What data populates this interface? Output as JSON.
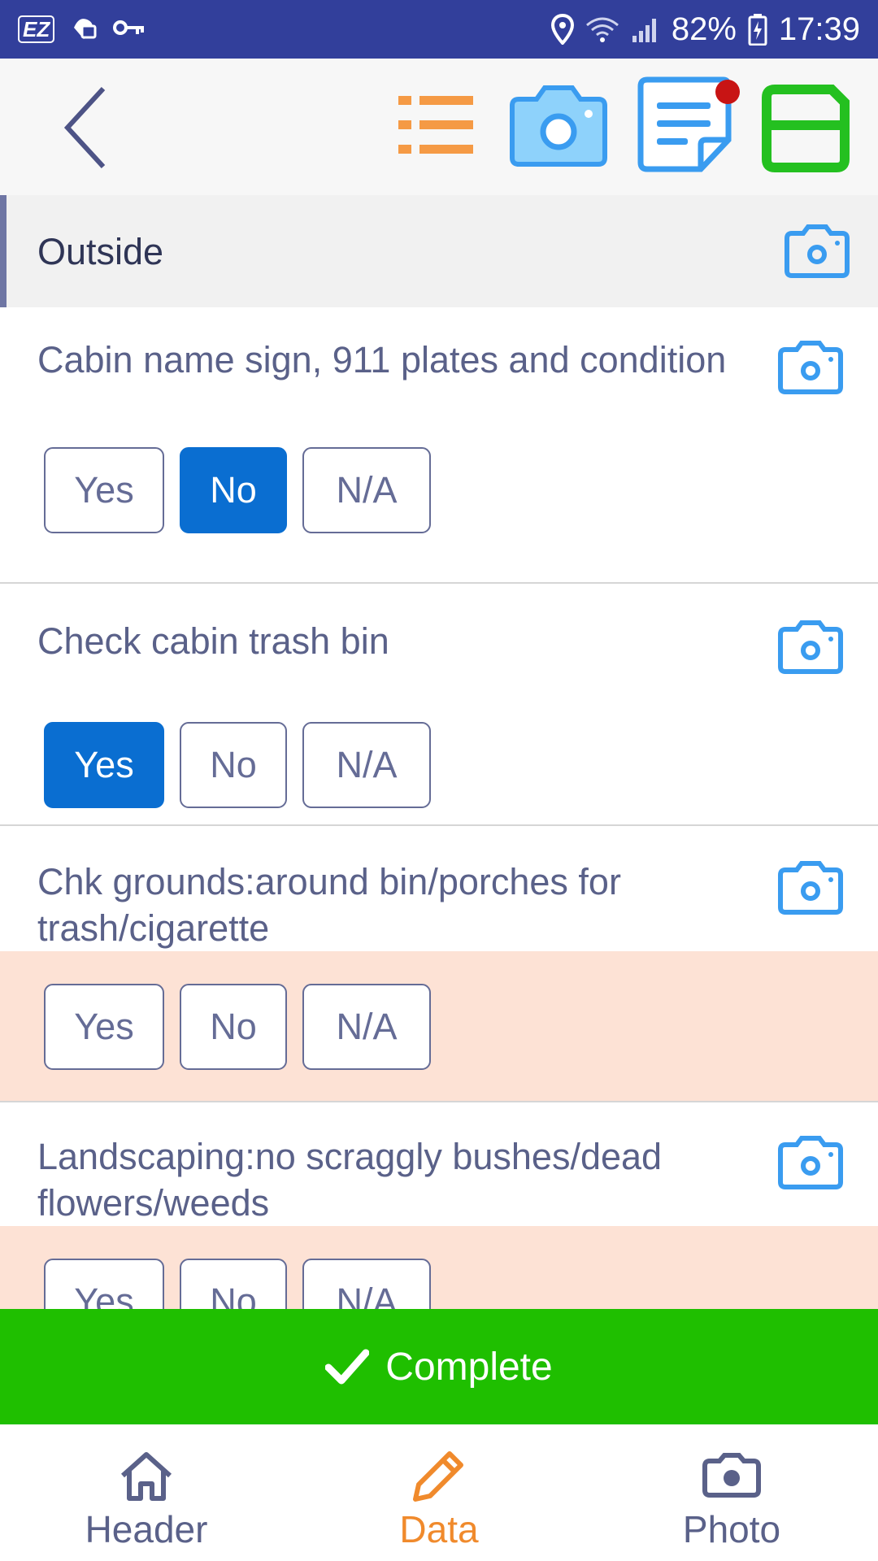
{
  "status_bar": {
    "ez_badge": "EZ",
    "battery": "82%",
    "time": "17:39"
  },
  "toolbar": {
    "icons": [
      "back-chevron-icon",
      "list-icon",
      "camera-icon",
      "note-icon",
      "save-icon"
    ],
    "colors": {
      "list": "#f59a45",
      "camera": "#3a9cf0",
      "note": "#3a9cf0",
      "save": "#24c020",
      "badge": "#c81414"
    }
  },
  "section": {
    "title": "Outside"
  },
  "questions": [
    {
      "text": "Cabin name sign, 911 plates and condition",
      "selected": "No"
    },
    {
      "text": "Check cabin trash bin",
      "selected": "Yes"
    },
    {
      "text": "Chk grounds:around bin/porches for trash/cigarette",
      "selected": ""
    },
    {
      "text": "Landscaping:no scraggly bushes/dead flowers/weeds",
      "selected": ""
    }
  ],
  "choices": {
    "yes": "Yes",
    "no": "No",
    "na": "N/A"
  },
  "complete_label": "Complete",
  "nav": {
    "header": "Header",
    "data": "Data",
    "photo": "Photo",
    "active": "Data"
  },
  "colors": {
    "selected": "#0a6ed1",
    "warn_band": "#fde2d5",
    "complete": "#1fbf00",
    "status_bar": "#323f9b"
  }
}
